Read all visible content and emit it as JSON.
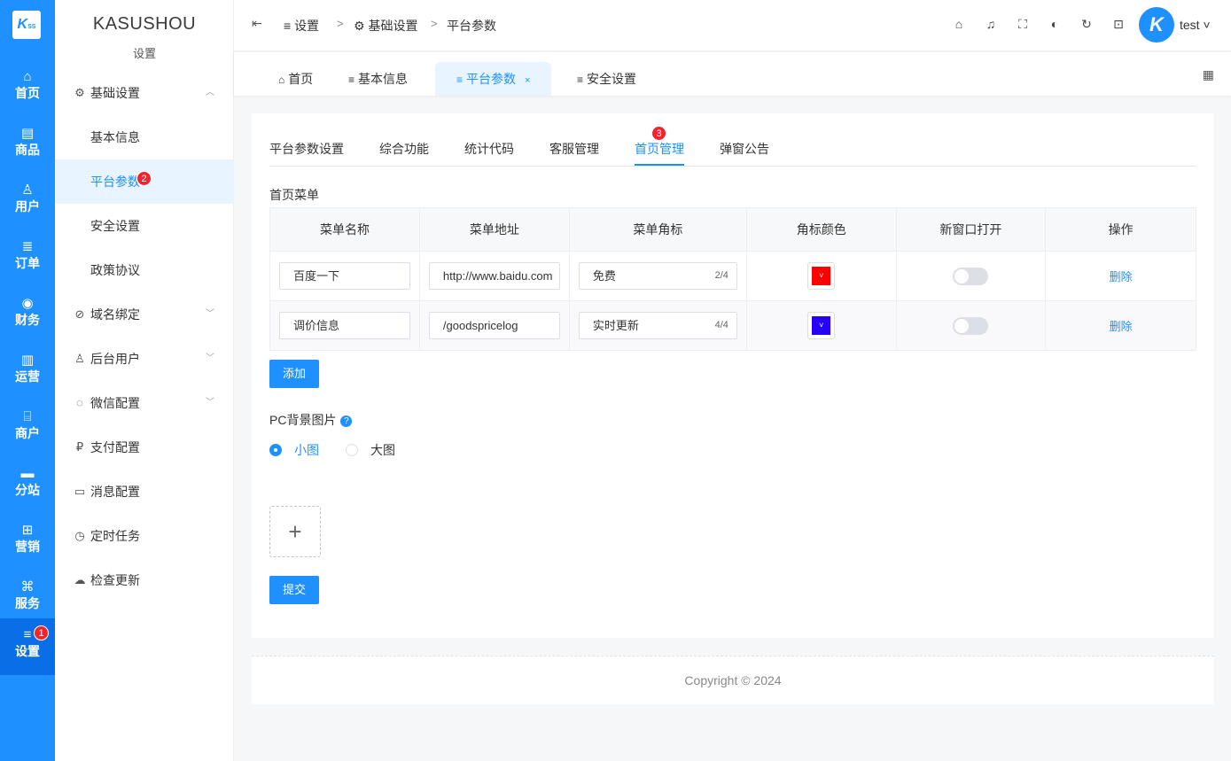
{
  "rail": {
    "logo": "K",
    "logo_sub": "SS",
    "items": [
      {
        "label": "首页",
        "icon": "⌂"
      },
      {
        "label": "商品",
        "icon": "▤"
      },
      {
        "label": "用户",
        "icon": "♙"
      },
      {
        "label": "订单",
        "icon": "≣"
      },
      {
        "label": "财务",
        "icon": "◉"
      },
      {
        "label": "运营",
        "icon": "▥"
      },
      {
        "label": "商户",
        "icon": "⌸"
      },
      {
        "label": "分站",
        "icon": "▬"
      },
      {
        "label": "营销",
        "icon": "⊞"
      },
      {
        "label": "服务",
        "icon": "⌘"
      },
      {
        "label": "设置",
        "icon": "≡",
        "badge": "1"
      }
    ]
  },
  "sidebar": {
    "brand": "KASUSHOU",
    "subtitle": "设置",
    "items": [
      {
        "label": "基础设置",
        "icon": "⚙",
        "arrow": "︿"
      },
      {
        "label": "基本信息"
      },
      {
        "label": "平台参数",
        "badge": "2"
      },
      {
        "label": "安全设置"
      },
      {
        "label": "政策协议"
      },
      {
        "label": "域名绑定",
        "icon": "⊘",
        "arrow": "﹀"
      },
      {
        "label": "后台用户",
        "icon": "♙",
        "arrow": "﹀"
      },
      {
        "label": "微信配置",
        "icon": "◌",
        "arrow": "﹀"
      },
      {
        "label": "支付配置",
        "icon": "₽"
      },
      {
        "label": "消息配置",
        "icon": "▭"
      },
      {
        "label": "定时任务",
        "icon": "◷"
      },
      {
        "label": "检查更新",
        "icon": "☁"
      }
    ]
  },
  "header": {
    "fold_icon": "⇤",
    "breadcrumb": [
      {
        "label": "设置",
        "icon": "≡"
      },
      {
        "label": "基础设置",
        "icon": "⚙"
      },
      {
        "label": "平台参数"
      }
    ],
    "icons": [
      "⌂",
      "♫",
      "⛶",
      "◐",
      "↻",
      "⊡"
    ],
    "avatar": "K",
    "user": "test ˅"
  },
  "page_tabs": [
    {
      "label": "首页",
      "icon": "⌂"
    },
    {
      "label": "基本信息",
      "icon": "≡"
    },
    {
      "label": "平台参数",
      "icon": "≡",
      "close": "×"
    },
    {
      "label": "安全设置",
      "icon": "≡"
    }
  ],
  "page_tabs_grid_icon": "▦",
  "content_tabs": {
    "items": [
      "平台参数设置",
      "综合功能",
      "统计代码",
      "客服管理",
      "首页管理",
      "弹窗公告"
    ],
    "active_badge": "3"
  },
  "menu_section": {
    "title": "首页菜单",
    "columns": [
      "菜单名称",
      "菜单地址",
      "菜单角标",
      "角标颜色",
      "新窗口打开",
      "操作"
    ],
    "rows": [
      {
        "name": "百度一下",
        "url": "http://www.baidu.com",
        "tag": "免费",
        "tag_count": "2/4",
        "color": "#ff0000",
        "new_window": false,
        "action": "删除"
      },
      {
        "name": "调价信息",
        "url": "/goodspricelog",
        "tag": "实时更新",
        "tag_count": "4/4",
        "color": "#2600ff",
        "new_window": false,
        "action": "删除"
      }
    ],
    "add_button": "添加"
  },
  "bg_section": {
    "title": "PC背景图片",
    "help": "?",
    "options": [
      {
        "label": "小图",
        "selected": true
      },
      {
        "label": "大图",
        "selected": false
      }
    ],
    "upload_icon": "+",
    "submit_button": "提交"
  },
  "footer": "Copyright © 2024"
}
